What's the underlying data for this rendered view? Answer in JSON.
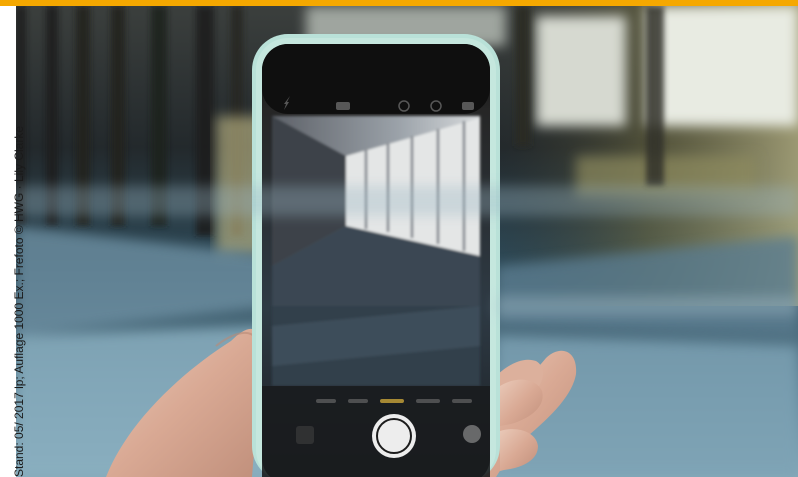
{
  "credit": {
    "text": "Stand: 05/ 2017 lp; Auflage 1000 Ex.; Frefoto © HWG · Lily Clarke"
  },
  "photo": {
    "subject": "hand-holding-phone",
    "phone_icons": [
      "flash-icon",
      "hdr-icon",
      "live-photo-icon",
      "timer-icon",
      "flip-camera-icon"
    ]
  },
  "colors": {
    "accent_bar": "#f5a800",
    "phone_case": "#b9e1d8",
    "phone_screen": "#141414"
  }
}
